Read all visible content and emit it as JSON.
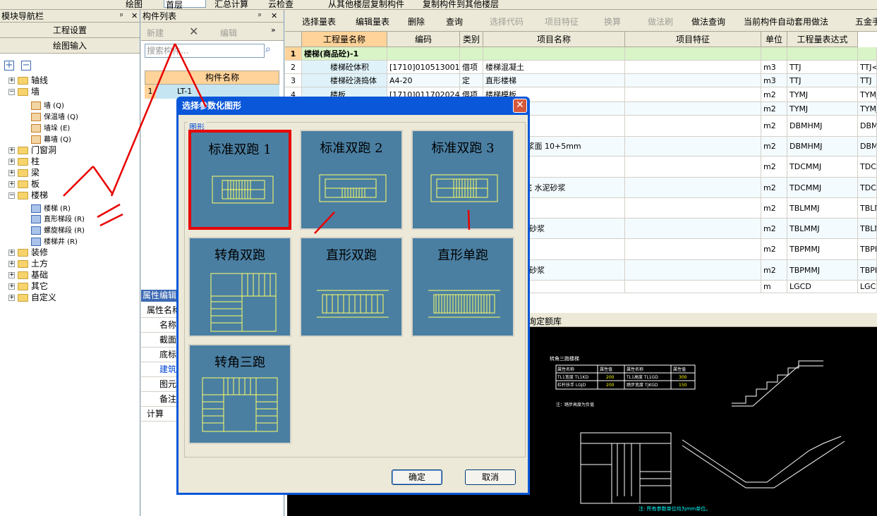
{
  "topbar": {
    "draw_label": "绘图",
    "floor_value": "首层",
    "sum_label": "汇总计算",
    "cloud_label": "云检查",
    "copy_from_label": "从其他楼层复制构件",
    "copy_to_label": "复制构件到其他楼层"
  },
  "nav": {
    "title": "模块导航栏",
    "pin": "ᵖ",
    "close": "✕",
    "btn_project": "工程设置",
    "btn_draw": "绘图输入",
    "tree": [
      {
        "label": "轴线",
        "level": 0,
        "exp": "+"
      },
      {
        "label": "墙",
        "level": 0,
        "exp": "−"
      },
      {
        "label": "墙 (Q)",
        "level": 1,
        "icon": "wall"
      },
      {
        "label": "保温墙 (Q)",
        "level": 1,
        "icon": "wall"
      },
      {
        "label": "墙垛 (E)",
        "level": 1,
        "icon": "wall"
      },
      {
        "label": "幕墙 (Q)",
        "level": 1,
        "icon": "wall"
      },
      {
        "label": "门窗洞",
        "level": 0,
        "exp": "+"
      },
      {
        "label": "柱",
        "level": 0,
        "exp": "+"
      },
      {
        "label": "梁",
        "level": 0,
        "exp": "+"
      },
      {
        "label": "板",
        "level": 0,
        "exp": "+"
      },
      {
        "label": "楼梯",
        "level": 0,
        "exp": "−"
      },
      {
        "label": "楼梯 (R)",
        "level": 1,
        "icon": "stair"
      },
      {
        "label": "直形梯段 (R)",
        "level": 1,
        "icon": "stair"
      },
      {
        "label": "螺旋梯段 (R)",
        "level": 1,
        "icon": "stair"
      },
      {
        "label": "楼梯井 (R)",
        "level": 1,
        "icon": "stair"
      },
      {
        "label": "装修",
        "level": 0,
        "exp": "+"
      },
      {
        "label": "土方",
        "level": 0,
        "exp": "+"
      },
      {
        "label": "基础",
        "level": 0,
        "exp": "+"
      },
      {
        "label": "其它",
        "level": 0,
        "exp": "+"
      },
      {
        "label": "自定义",
        "level": 0,
        "exp": "+"
      }
    ]
  },
  "comp": {
    "title": "构件列表",
    "new_label": "新建",
    "edit_label": "编辑",
    "search_placeholder": "搜索构件...",
    "col_name": "构件名称",
    "rows": [
      {
        "idx": "1",
        "name": "LT-1"
      }
    ],
    "prop_title": "属性编辑",
    "prop_rows": [
      "属性名称",
      "名称",
      "截面",
      "底标",
      "建筑",
      "图元",
      "备注",
      "计算"
    ]
  },
  "right": {
    "toolbar": [
      "选择量表",
      "编辑量表",
      "删除",
      "查询",
      "选择代码",
      "项目特征",
      "换算",
      "做法刷",
      "做法查询",
      "当前构件自动套用做法",
      "五金手"
    ],
    "headers": [
      "工程量名称",
      "编码",
      "类别",
      "项目名称",
      "项目特征",
      "单位",
      "工程量表达式"
    ],
    "rows": [
      {
        "n": "1",
        "name": "楼梯(商品砼)-1",
        "code": "",
        "type": "",
        "item": "",
        "unit": "",
        "expr": "",
        "expr2": ""
      },
      {
        "n": "2",
        "name": "楼梯砼体积",
        "code": "[1710]010513001",
        "type": "借项",
        "item": "楼梯混凝土",
        "unit": "m3",
        "expr": "TTJ",
        "expr2": "TTJ<"
      },
      {
        "n": "3",
        "name": "楼梯砼浇捣体",
        "code": "A4-20",
        "type": "定",
        "item": "直形楼梯",
        "unit": "m3",
        "expr": "TTJ",
        "expr2": "TTJ"
      },
      {
        "n": "4",
        "name": "楼板",
        "code": "[1710]011702024",
        "type": "借项",
        "item": "楼梯模板",
        "unit": "m2",
        "expr": "TYMJ",
        "expr2": "TYMJ"
      },
      {
        "n": "5",
        "name": "",
        "code": "",
        "type": "",
        "item": "形",
        "unit": "m2",
        "expr": "TYMJ",
        "expr2": "TYMJ"
      },
      {
        "n": "6",
        "name": "",
        "code": "",
        "type": "",
        "item": "",
        "unit": "m2",
        "expr": "DBMHMJ",
        "expr2": "DBMH"
      },
      {
        "n": "7",
        "name": "",
        "code": "",
        "type": "",
        "item": "浆底 石灰砂浆面 10+5mm",
        "unit": "m2",
        "expr": "DBMHMJ",
        "expr2": "DBMH"
      },
      {
        "n": "8",
        "name": "",
        "code": "",
        "type": "",
        "item": "般抹灰",
        "unit": "m2",
        "expr": "TDCMMJ",
        "expr2": "TDCM"
      },
      {
        "n": "9",
        "name": "",
        "code": "",
        "type": "",
        "item": "泥石灰砂浆底 水泥砂浆",
        "unit": "m2",
        "expr": "TDCMMJ",
        "expr2": "TDCM"
      },
      {
        "n": "10",
        "name": "",
        "code": "",
        "type": "",
        "item": "层",
        "unit": "m2",
        "expr": "TBLMMJ",
        "expr2": "TBLM"
      },
      {
        "n": "11",
        "name": "",
        "code": "",
        "type": "",
        "item": "料 楼梯 水泥砂浆",
        "unit": "m2",
        "expr": "TBLMMJ",
        "expr2": "TBLM"
      },
      {
        "n": "12",
        "name": "",
        "code": "",
        "type": "",
        "item": "层",
        "unit": "m2",
        "expr": "TBPMMJ",
        "expr2": "TBPM"
      },
      {
        "n": "13",
        "name": "",
        "code": "",
        "type": "",
        "item": "料 楼梯 水泥砂浆",
        "unit": "m2",
        "expr": "TBPMMJ",
        "expr2": "TBPM"
      },
      {
        "n": "14",
        "name": "",
        "code": "",
        "type": "",
        "item": "栏杆、栏板",
        "unit": "m",
        "expr": "LGCD",
        "expr2": "LGCD"
      }
    ],
    "lib_label": "询定额库"
  },
  "cad": {
    "title": "转角三跑楼梯",
    "table_headers": [
      "属性名称",
      "属性值",
      "属性名称",
      "属性值"
    ],
    "table_rows": [
      [
        "TL1宽度 TL1KD",
        "200",
        "TL1高度 TL1GD",
        "300"
      ],
      [
        "栏杆扶手 LGJD",
        "200",
        "踏步宽度 TJKGD",
        "150"
      ]
    ],
    "note": "注：踏步高度为负值",
    "footnote": "注: 所有参数单位均为mm单位。"
  },
  "dialog": {
    "title": "选择参数化图形",
    "close": "✕",
    "group_label": "图形",
    "tiles": [
      "标准双跑 1",
      "标准双跑 2",
      "标准双跑 3",
      "转角双跑",
      "直形双跑",
      "直形单跑",
      "转角三跑"
    ],
    "ok_label": "确定",
    "cancel_label": "取消"
  }
}
